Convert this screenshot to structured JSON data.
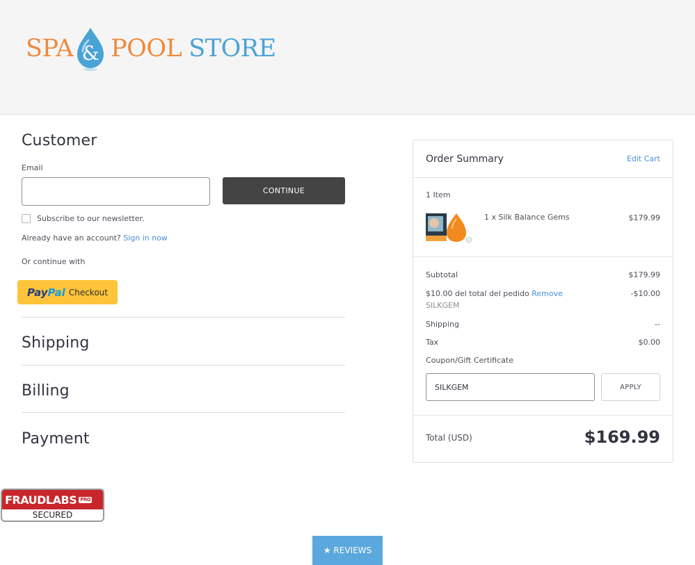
{
  "header": {
    "logo": {
      "word1": "SPA",
      "ampersand": "&",
      "word2": "POOL",
      "word3": "STORE"
    }
  },
  "customer": {
    "title": "Customer",
    "email_label": "Email",
    "email_value": "",
    "continue_label": "CONTINUE",
    "newsletter_label": "Subscribe to our newsletter.",
    "newsletter_checked": false,
    "account_prompt": "Already have an account?",
    "sign_in_label": "Sign in now",
    "or_continue": "Or continue with",
    "paypal": {
      "pay": "Pay",
      "pal": "Pal",
      "checkout": "Checkout"
    }
  },
  "steps": [
    {
      "label": "Shipping"
    },
    {
      "label": "Billing"
    },
    {
      "label": "Payment"
    }
  ],
  "summary": {
    "title": "Order Summary",
    "edit_cart": "Edit Cart",
    "item_count": "1 Item",
    "item": {
      "name": "1 x Silk Balance Gems",
      "price": "$179.99"
    },
    "subtotal_label": "Subtotal",
    "subtotal_value": "$179.99",
    "discount_label": "$10.00 del total del pedido",
    "discount_remove": "Remove",
    "discount_value": "-$10.00",
    "discount_code": "SILKGEM",
    "shipping_label": "Shipping",
    "shipping_value": "--",
    "tax_label": "Tax",
    "tax_value": "$0.00",
    "coupon_link": "Coupon/Gift Certificate",
    "coupon_value": "SILKGEM",
    "apply_label": "APPLY",
    "total_label": "Total (USD)",
    "total_value": "$169.99"
  },
  "badge": {
    "brand": "FRAUDLABS",
    "pro": "PRO",
    "secured": "SECURED"
  },
  "reviews": {
    "label": "★ REVIEWS"
  },
  "colors": {
    "link": "#4a90d9",
    "logo_orange": "#ee8a3c",
    "logo_blue": "#4aa3d6",
    "paypal": "#ffc439"
  }
}
